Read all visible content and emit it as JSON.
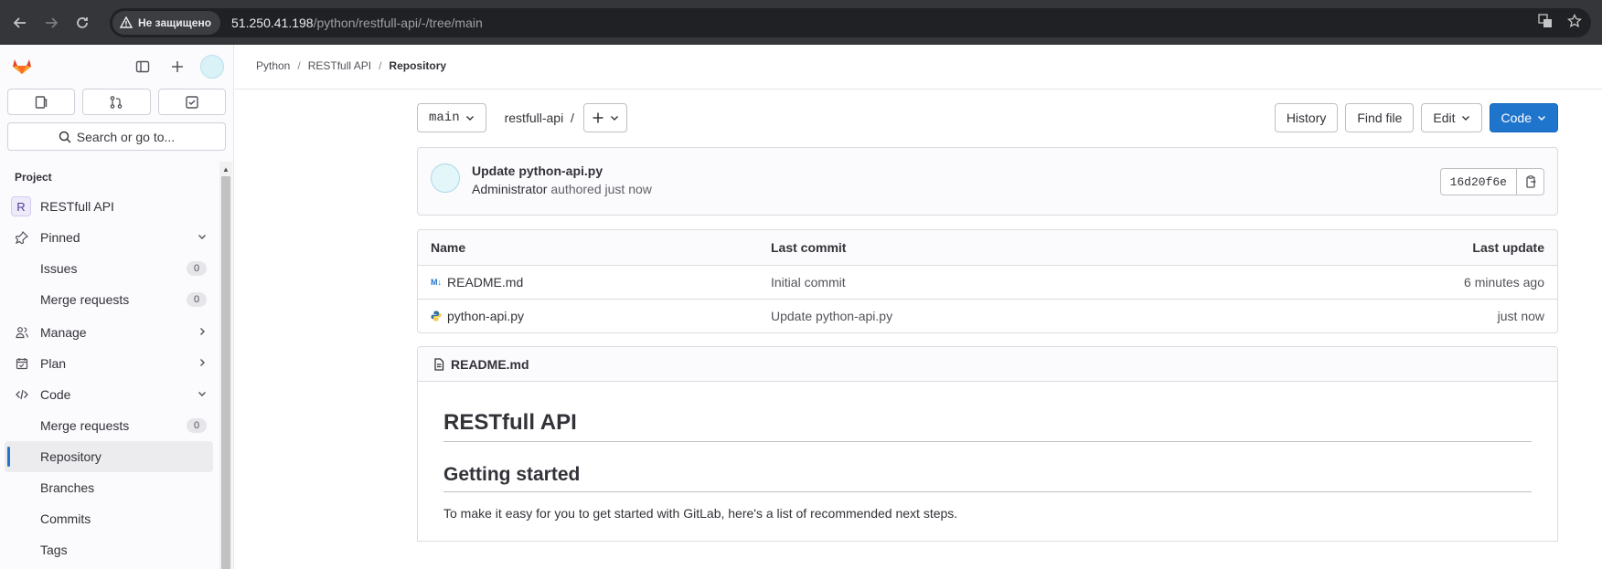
{
  "browser": {
    "security_label": "Не защищено",
    "url_host": "51.250.41.198",
    "url_path": "/python/restfull-api/-/tree/main"
  },
  "sidebar": {
    "search_label": "Search or go to...",
    "section_heading": "Project",
    "project_letter": "R",
    "project_name": "RESTfull API",
    "items": {
      "pinned": "Pinned",
      "issues": "Issues",
      "issues_count": "0",
      "pinned_merge_requests": "Merge requests",
      "pinned_mr_count": "0",
      "manage": "Manage",
      "plan": "Plan",
      "code": "Code",
      "code_merge_requests": "Merge requests",
      "code_mr_count": "0",
      "repository": "Repository",
      "branches": "Branches",
      "commits": "Commits",
      "tags": "Tags"
    }
  },
  "breadcrumb": {
    "group": "Python",
    "project": "RESTfull API",
    "current": "Repository"
  },
  "toolbar": {
    "branch": "main",
    "path": "restfull-api",
    "path_sep": "/",
    "history": "History",
    "find_file": "Find file",
    "edit": "Edit",
    "code": "Code"
  },
  "commit": {
    "title": "Update python-api.py",
    "author": "Administrator",
    "authored_text": "authored just now",
    "sha": "16d20f6e"
  },
  "file_table": {
    "headers": {
      "name": "Name",
      "last_commit": "Last commit",
      "last_update": "Last update"
    },
    "rows": [
      {
        "icon": "M↓",
        "name": "README.md",
        "last_commit": "Initial commit",
        "last_update": "6 minutes ago"
      },
      {
        "icon": "",
        "name": "python-api.py",
        "last_commit": "Update python-api.py",
        "last_update": "just now"
      }
    ]
  },
  "readme": {
    "filename": "README.md",
    "h1": "RESTfull API",
    "h2": "Getting started",
    "paragraph": "To make it easy for you to get started with GitLab, here's a list of recommended next steps."
  },
  "colors": {
    "primary": "#1f75cb",
    "browser_bar": "#35363a",
    "sidebar_bg": "#fbfafd"
  }
}
